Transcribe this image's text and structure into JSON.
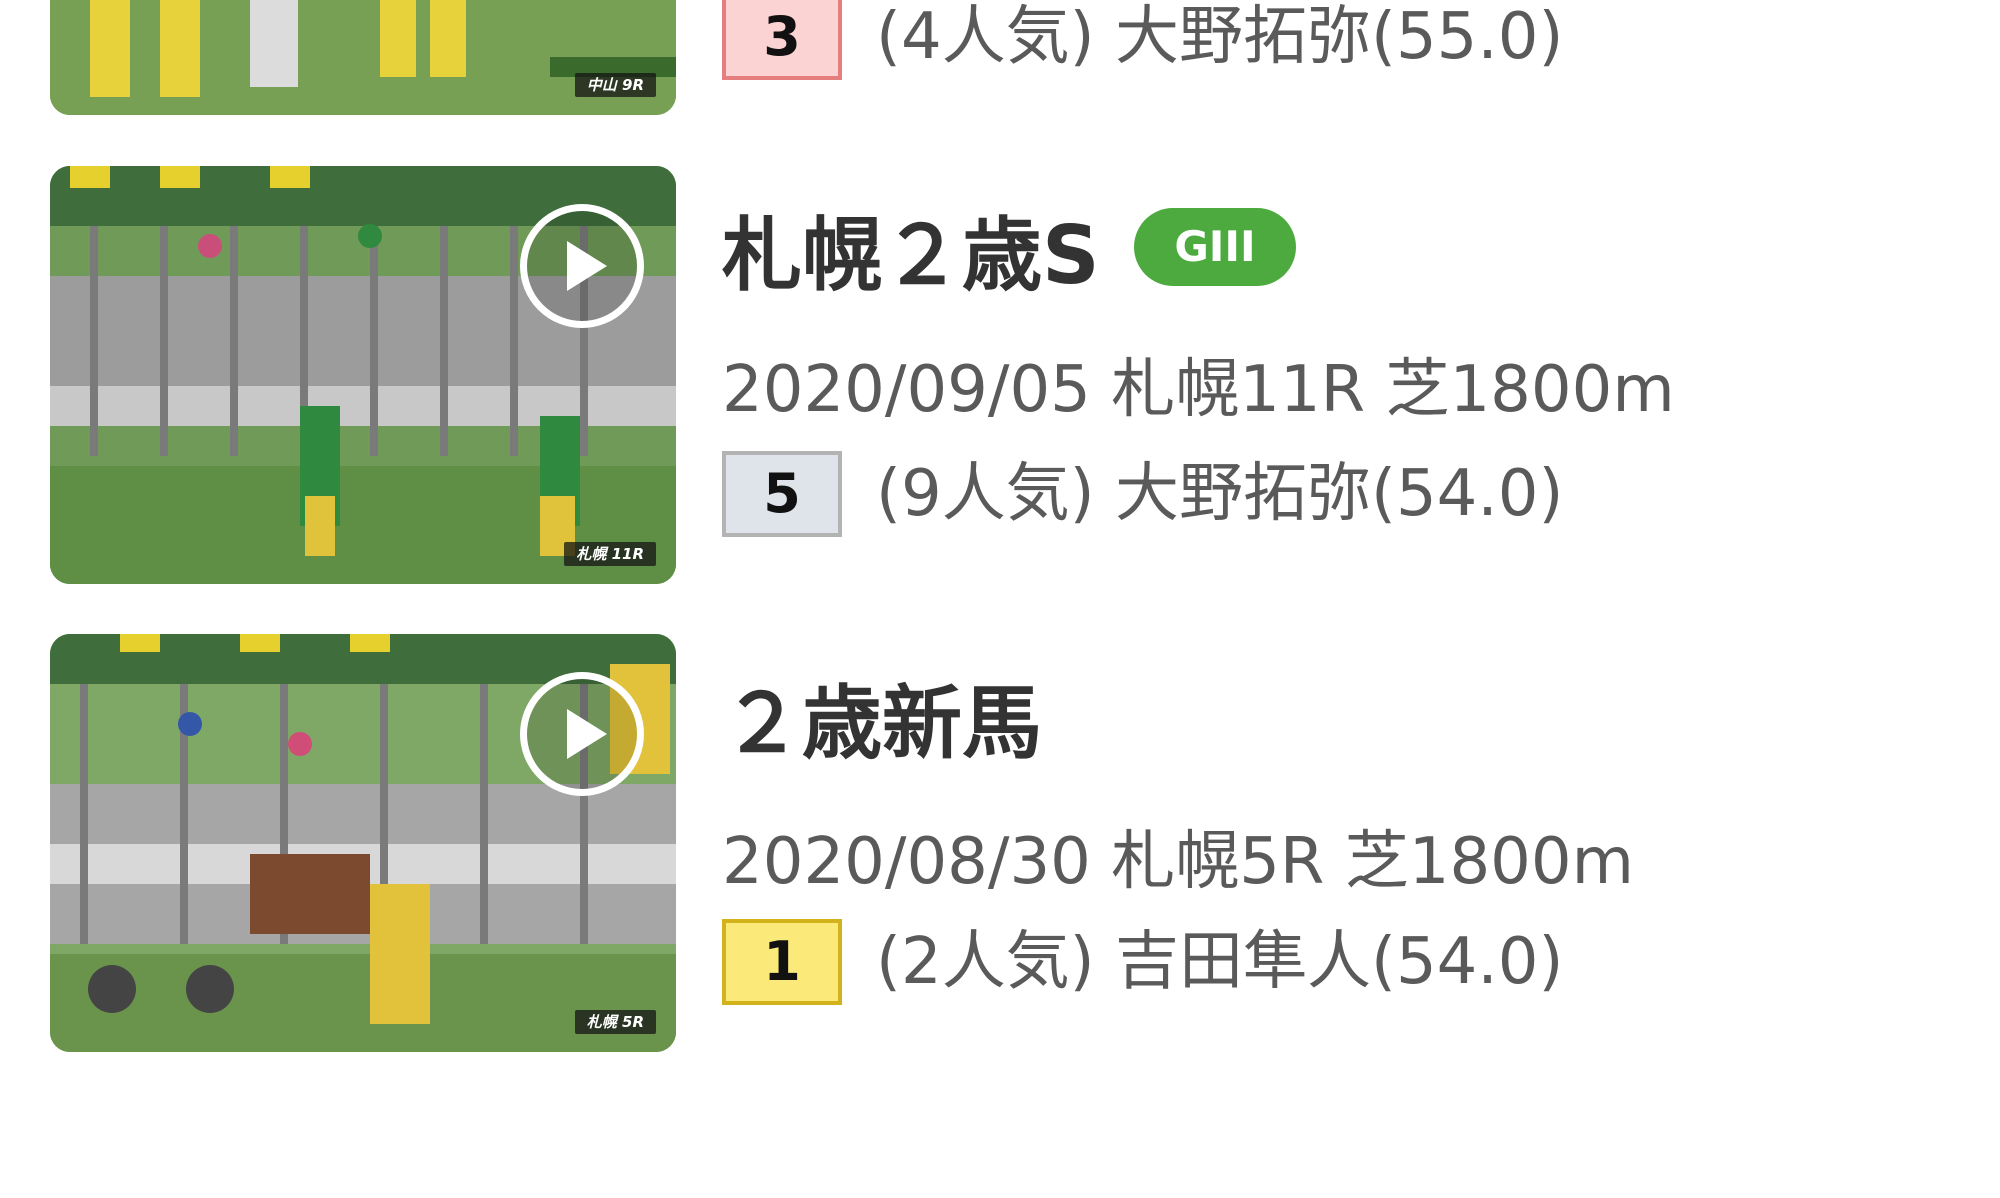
{
  "colors": {
    "grade_badge": "#4caa3f",
    "post_red": "#fcd3d3",
    "post_red_border": "#e57e7e",
    "post_white": "#dfe3ea",
    "post_white_border": "#b3b3b3",
    "post_yellow": "#fbe97a",
    "post_yellow_border": "#d3b31c"
  },
  "races": [
    {
      "id": "partial",
      "channel_tag": "中山 9R",
      "post_number": "3",
      "post_color": "red",
      "result_text": "(4人気) 大野拓弥(55.0)"
    },
    {
      "id": "sapporo-2sai-s",
      "channel_tag": "札幌 11R",
      "title": "札幌２歳S",
      "grade": "GIII",
      "meta": "2020/09/05 札幌11R 芝1800m",
      "post_number": "5",
      "post_color": "white",
      "result_text": "(9人気) 大野拓弥(54.0)"
    },
    {
      "id": "2sai-shinba",
      "channel_tag": "札幌 5R",
      "title": "２歳新馬",
      "meta": "2020/08/30 札幌5R 芝1800m",
      "post_number": "1",
      "post_color": "yellow",
      "result_text": "(2人気) 吉田隼人(54.0)"
    }
  ]
}
